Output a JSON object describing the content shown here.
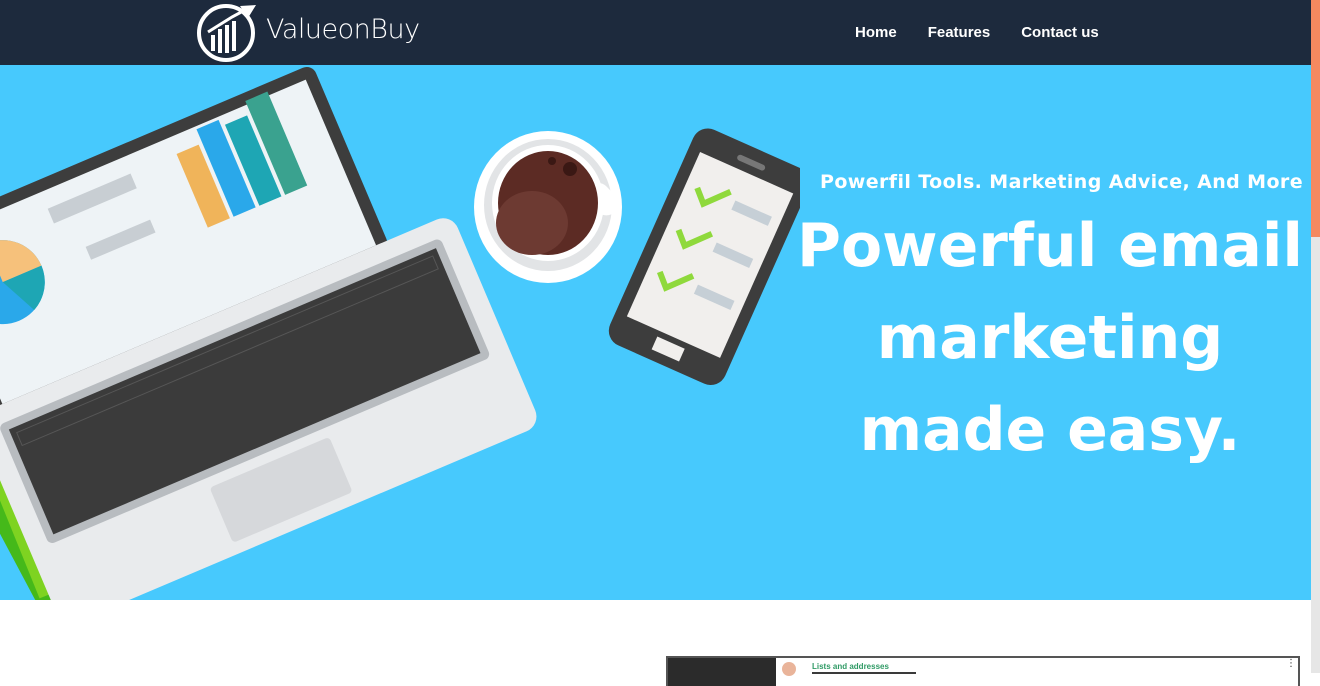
{
  "brand": {
    "name": "ValueonBuy",
    "logo_icon": "rising-bar-chart-logo"
  },
  "nav": {
    "items": [
      {
        "label": "Home"
      },
      {
        "label": "Features"
      },
      {
        "label": "Contact us"
      }
    ]
  },
  "hero": {
    "subtitle": "Powerfil Tools.  Marketing  Advice, And More",
    "title_lines": [
      "Powerful email",
      "marketing",
      " made easy."
    ],
    "background": "#47c9fd",
    "illustration": "laptop-coffee-phone-coins-illustration"
  },
  "preview": {
    "label": "Lists and addresses"
  },
  "theme": {
    "navbar_bg": "#1d2a3d",
    "accent": "#f5895f",
    "check_green": "#8fd93c"
  }
}
